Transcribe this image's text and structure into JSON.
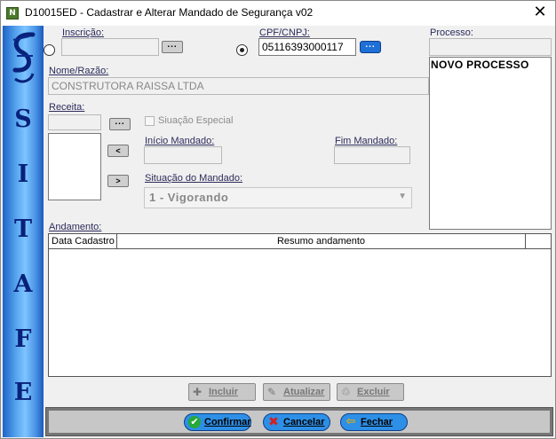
{
  "window": {
    "title": "D10015ED - Cadastrar e Alterar Mandado de Segurança v02",
    "icon_label": "N",
    "close_glyph": "✕"
  },
  "sidebar": {
    "letters": [
      "S",
      "I",
      "T",
      "A",
      "F",
      "E"
    ]
  },
  "form": {
    "inscricao_label": "Inscrição:",
    "cpf_label": "CPF/CNPJ:",
    "cpf_value": "05116393000117",
    "processo_label": "Processo:",
    "nome_label": "Nome/Razão:",
    "nome_value": "CONSTRUTORA RAISSA LTDA",
    "receita_label": "Receita:",
    "situacao_especial_label": "Siuação Especial",
    "inicio_label": "Início Mandado:",
    "fim_label": "Fim Mandado:",
    "situacao_mandado_label": "Situação do Mandado:",
    "situacao_mandado_value": "1 - Vigorando",
    "lookup_label": "...",
    "add_arrow": "<",
    "remove_arrow": ">"
  },
  "processos": [
    "NOVO PROCESSO"
  ],
  "andamento": {
    "label": "Andamento:",
    "columns": [
      "Data Cadastro",
      "Resumo andamento"
    ]
  },
  "actions": {
    "incluir": "Incluir",
    "atualizar": "Atualizar",
    "excluir": "Excluir"
  },
  "footer": {
    "confirmar": "Confirmar",
    "cancelar": "Cancelar",
    "fechar": "Fechar"
  }
}
